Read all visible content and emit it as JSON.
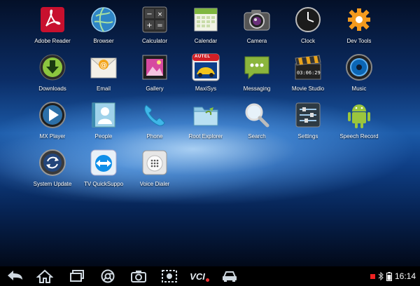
{
  "apps": [
    {
      "label": "Adobe Reader",
      "icon": "adobe-reader-icon"
    },
    {
      "label": "Browser",
      "icon": "globe-icon"
    },
    {
      "label": "Calculator",
      "icon": "calculator-icon"
    },
    {
      "label": "Calendar",
      "icon": "calendar-icon"
    },
    {
      "label": "Camera",
      "icon": "camera-icon"
    },
    {
      "label": "Clock",
      "icon": "clock-icon"
    },
    {
      "label": "Dev Tools",
      "icon": "gear-icon"
    },
    {
      "label": "Downloads",
      "icon": "download-icon"
    },
    {
      "label": "Email",
      "icon": "email-icon"
    },
    {
      "label": "Gallery",
      "icon": "gallery-icon"
    },
    {
      "label": "MaxiSys",
      "icon": "maxisys-icon",
      "badge": "AUTEL"
    },
    {
      "label": "Messaging",
      "icon": "messaging-icon"
    },
    {
      "label": "Movie Studio",
      "icon": "movie-studio-icon",
      "clapper": "03:06:29"
    },
    {
      "label": "Music",
      "icon": "music-icon"
    },
    {
      "label": "MX Player",
      "icon": "play-icon"
    },
    {
      "label": "People",
      "icon": "people-icon"
    },
    {
      "label": "Phone",
      "icon": "phone-icon"
    },
    {
      "label": "Root Explorer",
      "icon": "folder-icon"
    },
    {
      "label": "Search",
      "icon": "search-icon"
    },
    {
      "label": "Settings",
      "icon": "settings-icon"
    },
    {
      "label": "Speech Record",
      "icon": "android-icon"
    },
    {
      "label": "System Update",
      "icon": "system-update-icon"
    },
    {
      "label": "TV QuickSuppo",
      "icon": "teamviewer-icon"
    },
    {
      "label": "Voice Dialer",
      "icon": "voice-dialer-icon"
    }
  ],
  "navbar": {
    "buttons": [
      "back-icon",
      "home-icon",
      "recent-apps-icon",
      "chrome-icon",
      "camera-icon",
      "screenshot-icon",
      "vci-icon",
      "car-icon"
    ],
    "vci_label": "VCI",
    "clock": "16:14"
  },
  "colors": {
    "adobe": "#c8102e",
    "android_green": "#9bc53d",
    "navbar": "#000000"
  }
}
